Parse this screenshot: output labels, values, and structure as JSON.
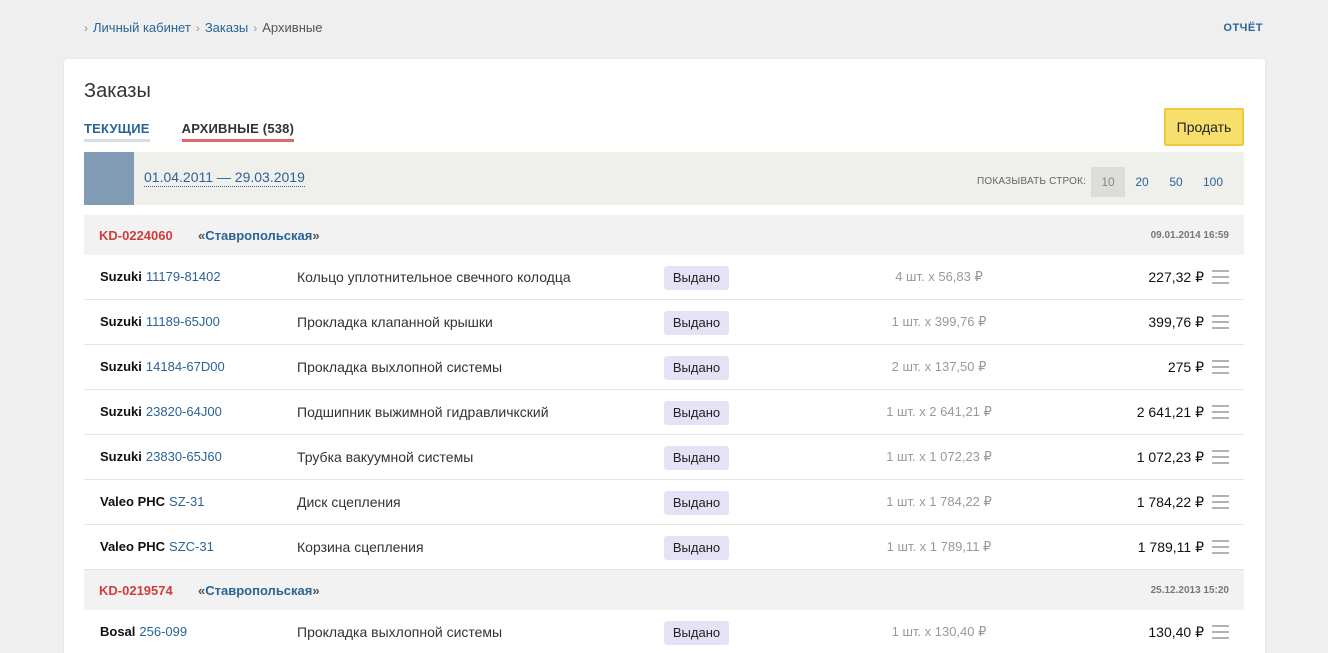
{
  "breadcrumb": [
    {
      "label": "Личный кабинет",
      "link": true
    },
    {
      "label": "Заказы",
      "link": true
    },
    {
      "label": "Архивные",
      "link": false
    }
  ],
  "report_label": "ОТЧЁТ",
  "page_title": "Заказы",
  "tabs": [
    {
      "label": "ТЕКУЩИЕ",
      "active": false
    },
    {
      "label": "АРХИВНЫЕ (538)",
      "active": true
    }
  ],
  "sell_button": "Продать",
  "filter": {
    "date_range": "01.04.2011 — 29.03.2019",
    "rows_label": "ПОКАЗЫВАТЬ СТРОК:",
    "rows_options": [
      "10",
      "20",
      "50",
      "100"
    ],
    "rows_selected": "10"
  },
  "orders": [
    {
      "number": "KD-0224060",
      "store": "Ставропольская",
      "date": "09.01.2014 16:59",
      "items": [
        {
          "brand": "Suzuki",
          "part": "11179-81402",
          "desc": "Кольцо уплотнительное свечного колодца",
          "status": "Выдано",
          "qty": "4 шт. x 56,83 ₽",
          "total": "227,32 ₽"
        },
        {
          "brand": "Suzuki",
          "part": "11189-65J00",
          "desc": "Прокладка клапанной крышки",
          "status": "Выдано",
          "qty": "1 шт. x 399,76 ₽",
          "total": "399,76 ₽"
        },
        {
          "brand": "Suzuki",
          "part": "14184-67D00",
          "desc": "Прокладка выхлопной системы",
          "status": "Выдано",
          "qty": "2 шт. x 137,50 ₽",
          "total": "275 ₽"
        },
        {
          "brand": "Suzuki",
          "part": "23820-64J00",
          "desc": "Подшипник выжимной гидравличкский",
          "status": "Выдано",
          "qty": "1 шт. x 2 641,21 ₽",
          "total": "2 641,21 ₽"
        },
        {
          "brand": "Suzuki",
          "part": "23830-65J60",
          "desc": "Трубка вакуумной системы",
          "status": "Выдано",
          "qty": "1 шт. x 1 072,23 ₽",
          "total": "1 072,23 ₽"
        },
        {
          "brand": "Valeo PHC",
          "part": "SZ-31",
          "desc": "Диск сцепления",
          "status": "Выдано",
          "qty": "1 шт. x 1 784,22 ₽",
          "total": "1 784,22 ₽"
        },
        {
          "brand": "Valeo PHC",
          "part": "SZC-31",
          "desc": "Корзина сцепления",
          "status": "Выдано",
          "qty": "1 шт. x 1 789,11 ₽",
          "total": "1 789,11 ₽"
        }
      ]
    },
    {
      "number": "KD-0219574",
      "store": "Ставропольская",
      "date": "25.12.2013 15:20",
      "items": [
        {
          "brand": "Bosal",
          "part": "256-099",
          "desc": "Прокладка выхлопной системы",
          "status": "Выдано",
          "qty": "1 шт. x 130,40 ₽",
          "total": "130,40 ₽"
        }
      ]
    }
  ],
  "colors": {
    "link": "#2a6496",
    "order_number": "#d03d3d",
    "sell_button": "#f7df6b",
    "status_badge": "#e3e3f5",
    "color_block": "#829bb4"
  }
}
